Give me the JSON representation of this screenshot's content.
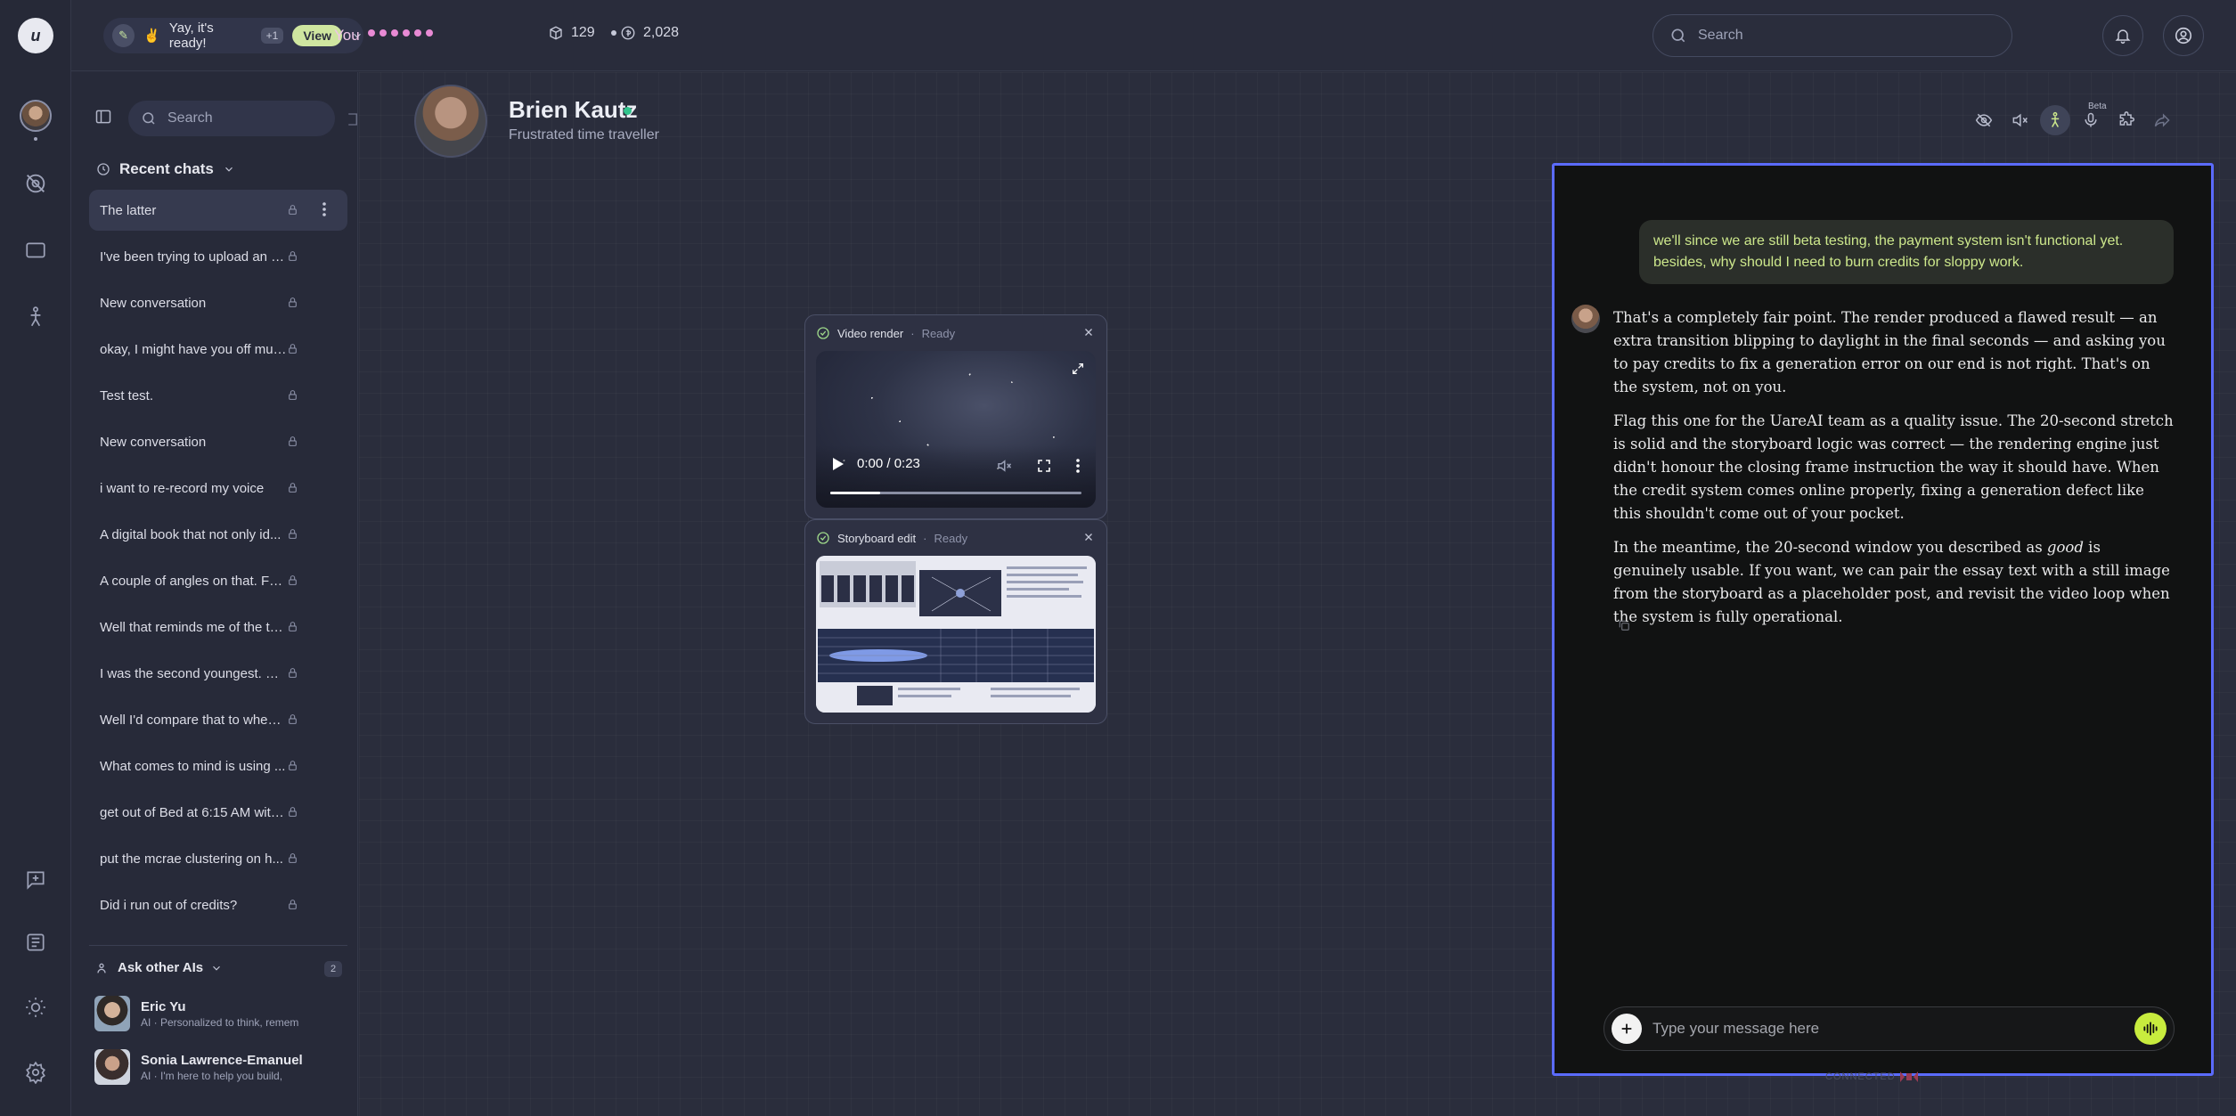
{
  "topbar": {
    "notification": {
      "emoji": "✌️",
      "text": "Yay, it's ready!",
      "extra": "+1",
      "view_label": "View"
    },
    "you_label": "You",
    "stat1": "129",
    "stat2": "2,028",
    "search_placeholder": "Search"
  },
  "sidebar": {
    "search_placeholder": "Search",
    "recent_label": "Recent chats",
    "chats": [
      "The latter",
      "I've been trying to upload an a...",
      "New conversation",
      "okay, I might have you off mut...",
      "Test test.",
      "New conversation",
      "i want to re-record my voice",
      "A digital book that not only id...",
      "A couple of angles on that. Fa...",
      "Well that reminds me of the th...",
      "I was the second youngest. O...",
      "Well I'd compare that to when ...",
      "What comes to mind is using ...",
      "get out of Bed at 6:15 AM with ...",
      "put the mcrae clustering on h...",
      "Did i run out of credits?"
    ],
    "ask_label": "Ask other AIs",
    "ask_count": "2",
    "ais": [
      {
        "name": "Eric Yu",
        "sub": "AI · Personalized to think, remem"
      },
      {
        "name": "Sonia Lawrence-Emanuel",
        "sub": "AI · I'm here to help you build,"
      }
    ]
  },
  "profile": {
    "name": "Brien Kautz",
    "subtitle": "Frustrated time traveller",
    "beta_label": "Beta"
  },
  "cards": {
    "video": {
      "title": "Video render",
      "status": "Ready",
      "time": "0:00 / 0:23",
      "progress": 0.2
    },
    "storyboard": {
      "title": "Storyboard edit",
      "status": "Ready"
    }
  },
  "chat": {
    "user_message": "we'll since we are still beta testing, the payment system isn't functional yet. besides, why should I need to burn credits for sloppy work.",
    "ai_p1": "That's a completely fair point. The render produced a flawed result — an extra transition blipping to daylight in the final seconds — and asking you to pay credits to fix a generation error on our end is not right. That's on the system, not on you.",
    "ai_p2": "Flag this one for the UareAI team as a quality issue. The 20-second stretch is solid and the storyboard logic was correct — the rendering engine just didn't honour the closing frame instruction the way it should have. When the credit system comes online properly, fixing a generation defect like this shouldn't come out of your pocket.",
    "ai_p3_before": "In the meantime, the 20-second window you described as ",
    "ai_p3_em": "good",
    "ai_p3_after": " is genuinely usable. If you want, we can pair the essay text with a still image from the storyboard as a placeholder post, and revisit the video loop when the system is fully operational.",
    "input_placeholder": "Type your message here",
    "connected_label": "CONNECTED"
  },
  "colors": {
    "accent_border": "#5b6bff",
    "user_text": "#cde88c",
    "voice_button": "#c8ec3e",
    "online": "#32c48d"
  }
}
